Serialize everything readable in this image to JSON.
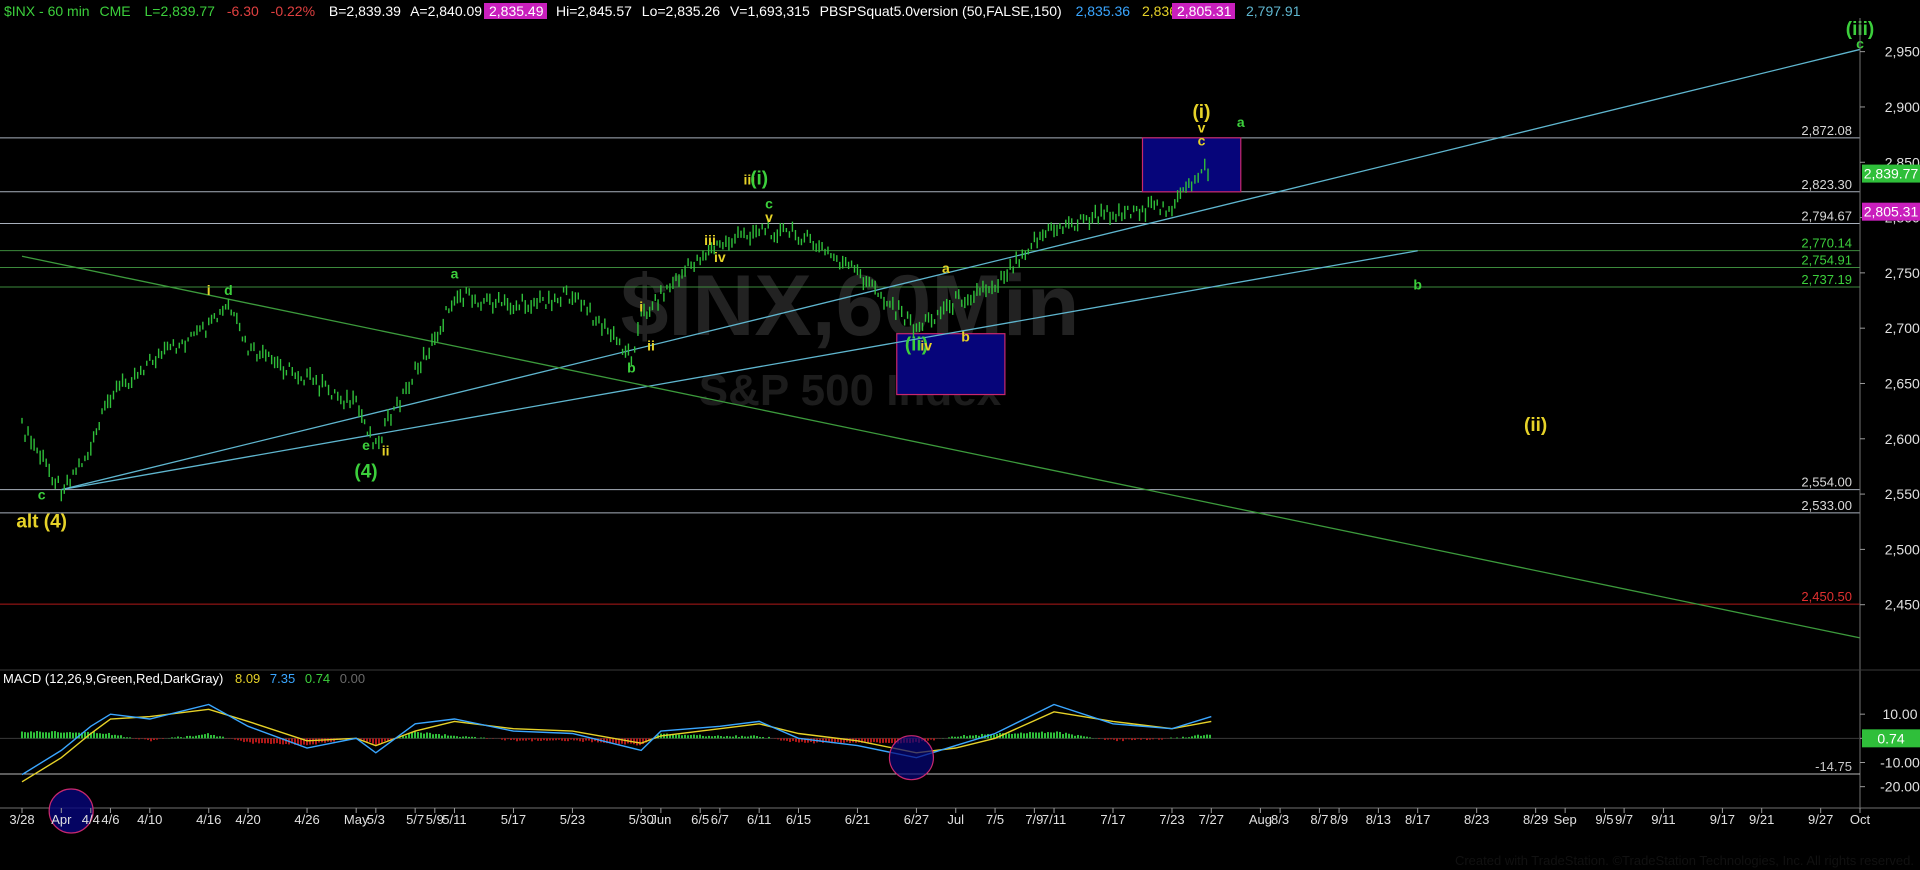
{
  "header": {
    "symbol": "$INX - 60 min",
    "exchange": "CME",
    "last": "L=2,839.77",
    "change": "-6.30",
    "change_pct": "-0.22%",
    "bid": "B=2,839.39",
    "ask": "A=2,840.09",
    "boxed_value": "2,835.49",
    "hi": "Hi=2,845.57",
    "lo": "Lo=2,835.26",
    "volume": "V=1,693,315",
    "study": "PBSPSquat5.0version (50,FALSE,150)",
    "study_values": [
      "2,835.36",
      "2,836.77",
      "2,805.31",
      "2,797.91"
    ]
  },
  "watermark": {
    "big": "$INX,60Min",
    "small": "S&P 500 Index"
  },
  "macd_header": {
    "label": "MACD (12,26,9,Green,Red,DarkGray)",
    "values": [
      "8.09",
      "7.35",
      "0.74",
      "0.00"
    ]
  },
  "footer": "Created with TradeStation. ©TradeStation Technologies, Inc. All rights reserved.",
  "colors": {
    "background": "#000000",
    "price": "#2fbf3a",
    "trendline": "#5fb6cf",
    "downline": "#3c9a3c",
    "level_line": "#a8b0bc",
    "level_line_green": "#3c8a3c",
    "support_red": "#b01818",
    "box_fill": "#06057a",
    "box_border": "#c8286e",
    "green_label": "#3ccf3c",
    "yellow_label": "#e6d228",
    "macd_line": "#3aa6ff",
    "signal_line": "#e6d228",
    "hist_pos": "#2fbf3a",
    "hist_neg": "#b01818",
    "last_price_badge": "#2fbf3a",
    "magenta_badge": "#c91fbd"
  },
  "chart_data": {
    "type": "candlestick",
    "title": "$INX - 60 min",
    "x": [
      "3/28",
      "Apr",
      "4/4",
      "4/6",
      "4/10",
      "4/16",
      "4/20",
      "4/26",
      "May",
      "5/3",
      "5/7",
      "5/9",
      "5/11",
      "5/17",
      "5/23",
      "5/30",
      "Jun",
      "6/5",
      "6/7",
      "6/11",
      "6/15",
      "6/21",
      "6/27",
      "Jul",
      "7/5",
      "7/9",
      "7/11",
      "7/17",
      "7/23",
      "7/27",
      "Aug",
      "8/3",
      "8/7",
      "8/9",
      "8/13",
      "8/17",
      "8/23",
      "8/29",
      "Sep",
      "9/5",
      "9/7",
      "9/11",
      "9/17",
      "9/21",
      "9/27",
      "Oct"
    ],
    "ylim": [
      2400,
      2975
    ],
    "y_ticks": [
      "2,950.00",
      "2,900.00",
      "2,850.00",
      "2,800.00",
      "2,750.00",
      "2,700.00",
      "2,650.00",
      "2,600.00",
      "2,550.00",
      "2,500.00",
      "2,450.00"
    ],
    "price_path": [
      [
        "3/28",
        2610
      ],
      [
        "Apr",
        2555
      ],
      [
        "4/4",
        2590
      ],
      [
        "4/6",
        2640
      ],
      [
        "4/10",
        2670
      ],
      [
        "4/16",
        2700
      ],
      [
        "4/18",
        2720
      ],
      [
        "4/20",
        2680
      ],
      [
        "4/26",
        2655
      ],
      [
        "May",
        2630
      ],
      [
        "5/3",
        2595
      ],
      [
        "5/7",
        2660
      ],
      [
        "5/9",
        2690
      ],
      [
        "5/11",
        2730
      ],
      [
        "5/17",
        2720
      ],
      [
        "5/23",
        2730
      ],
      [
        "5/29",
        2675
      ],
      [
        "5/30",
        2710
      ],
      [
        "Jun",
        2730
      ],
      [
        "6/5",
        2765
      ],
      [
        "6/7",
        2775
      ],
      [
        "6/11",
        2790
      ],
      [
        "6/15",
        2785
      ],
      [
        "6/21",
        2750
      ],
      [
        "6/27",
        2700
      ],
      [
        "Jul",
        2725
      ],
      [
        "7/5",
        2740
      ],
      [
        "7/9",
        2780
      ],
      [
        "7/11",
        2790
      ],
      [
        "7/17",
        2805
      ],
      [
        "7/23",
        2810
      ],
      [
        "7/25",
        2830
      ],
      [
        "7/26",
        2845
      ],
      [
        "7/27",
        2839.77
      ]
    ],
    "horizontal_levels": [
      {
        "value": 2872.08,
        "label": "2,872.08"
      },
      {
        "value": 2823.3,
        "label": "2,823.30"
      },
      {
        "value": 2794.67,
        "label": "2,794.67"
      },
      {
        "value": 2770.14,
        "label": "2,770.14"
      },
      {
        "value": 2754.91,
        "label": "2,754.91"
      },
      {
        "value": 2737.19,
        "label": "2,737.19"
      },
      {
        "value": 2554.0,
        "label": "2,554.00"
      },
      {
        "value": 2533.0,
        "label": "2,533.00"
      },
      {
        "value": 2450.5,
        "label": "2,450.50"
      }
    ],
    "last_price": {
      "value": 2839.77,
      "label": "2,839.77"
    },
    "secondary_badge": {
      "value": 2805.31,
      "label": "2,805.31"
    },
    "trendlines": [
      {
        "from": [
          "Apr",
          2554
        ],
        "to": [
          "Oct",
          2952
        ]
      },
      {
        "from": [
          "Apr",
          2554
        ],
        "to": [
          "8/17",
          2770
        ]
      },
      {
        "from": [
          "3/28",
          2765
        ],
        "to": [
          "Oct",
          2420
        ]
      }
    ],
    "boxes": [
      {
        "x0": "7/20",
        "x1": "7/30",
        "y0": 2823.3,
        "y1": 2872.08
      },
      {
        "x0": "6/25",
        "x1": "7/6",
        "y0": 2640,
        "y1": 2695
      }
    ],
    "wave_labels": [
      {
        "text": "alt (4)",
        "x": "3/30",
        "y": 2520,
        "color": "yellow"
      },
      {
        "text": "c",
        "x": "3/30",
        "y": 2545,
        "color": "green"
      },
      {
        "text": "i",
        "x": "4/16",
        "y": 2730,
        "color": "yellow"
      },
      {
        "text": "d",
        "x": "4/18",
        "y": 2730,
        "color": "green"
      },
      {
        "text": "e",
        "x": "5/2",
        "y": 2590,
        "color": "green"
      },
      {
        "text": "(4)",
        "x": "5/2",
        "y": 2565,
        "color": "green"
      },
      {
        "text": "ii",
        "x": "5/4",
        "y": 2585,
        "color": "yellow"
      },
      {
        "text": "a",
        "x": "5/11",
        "y": 2745,
        "color": "green"
      },
      {
        "text": "b",
        "x": "5/29",
        "y": 2660,
        "color": "green"
      },
      {
        "text": "i",
        "x": "5/30",
        "y": 2715,
        "color": "yellow"
      },
      {
        "text": "ii",
        "x": "5/31",
        "y": 2680,
        "color": "yellow"
      },
      {
        "text": "iii",
        "x": "6/6",
        "y": 2775,
        "color": "yellow"
      },
      {
        "text": "iv",
        "x": "6/7",
        "y": 2760,
        "color": "yellow"
      },
      {
        "text": "iii",
        "x": "6/10",
        "y": 2830,
        "color": "yellow"
      },
      {
        "text": "(i)",
        "x": "6/11",
        "y": 2830,
        "color": "green"
      },
      {
        "text": "c",
        "x": "6/12",
        "y": 2808,
        "color": "green"
      },
      {
        "text": "v",
        "x": "6/12",
        "y": 2796,
        "color": "yellow"
      },
      {
        "text": "(ii)",
        "x": "6/27",
        "y": 2680,
        "color": "green"
      },
      {
        "text": "iv",
        "x": "6/28",
        "y": 2680,
        "color": "yellow"
      },
      {
        "text": "a",
        "x": "6/30",
        "y": 2750,
        "color": "yellow"
      },
      {
        "text": "b",
        "x": "7/2",
        "y": 2688,
        "color": "yellow"
      },
      {
        "text": "(i)",
        "x": "7/26",
        "y": 2890,
        "color": "yellow"
      },
      {
        "text": "v",
        "x": "7/26",
        "y": 2877,
        "color": "yellow"
      },
      {
        "text": "c",
        "x": "7/26",
        "y": 2865,
        "color": "yellow"
      },
      {
        "text": "a",
        "x": "7/30",
        "y": 2882,
        "color": "green"
      },
      {
        "text": "b",
        "x": "8/17",
        "y": 2735,
        "color": "green"
      },
      {
        "text": "(ii)",
        "x": "8/29",
        "y": 2607,
        "color": "yellow"
      },
      {
        "text": "(iii)",
        "x": "10/1",
        "y": 2965,
        "color": "green"
      },
      {
        "text": "c",
        "x": "10/1",
        "y": 2953,
        "color": "green"
      }
    ],
    "macd": {
      "ylim": [
        -28,
        20
      ],
      "y_ticks": [
        "10.00",
        "0.00",
        "-10.00",
        "-20.00"
      ],
      "zero_badge": "0.74",
      "lower_line": {
        "value": -14.75,
        "label": "-14.75"
      },
      "macd_path": [
        [
          "3/28",
          -15
        ],
        [
          "Apr",
          -5
        ],
        [
          "4/4",
          5
        ],
        [
          "4/6",
          10
        ],
        [
          "4/10",
          8
        ],
        [
          "4/16",
          14
        ],
        [
          "4/20",
          5
        ],
        [
          "4/26",
          -4
        ],
        [
          "May",
          0
        ],
        [
          "5/3",
          -6
        ],
        [
          "5/7",
          6
        ],
        [
          "5/11",
          8
        ],
        [
          "5/17",
          3
        ],
        [
          "5/23",
          2
        ],
        [
          "5/30",
          -5
        ],
        [
          "Jun",
          3
        ],
        [
          "6/7",
          5
        ],
        [
          "6/11",
          7
        ],
        [
          "6/15",
          0
        ],
        [
          "6/21",
          -3
        ],
        [
          "6/27",
          -8
        ],
        [
          "Jul",
          -3
        ],
        [
          "7/5",
          2
        ],
        [
          "7/11",
          14
        ],
        [
          "7/17",
          6
        ],
        [
          "7/23",
          4
        ],
        [
          "7/27",
          9
        ]
      ],
      "signal_path": [
        [
          "3/28",
          -18
        ],
        [
          "Apr",
          -8
        ],
        [
          "4/4",
          2
        ],
        [
          "4/6",
          8
        ],
        [
          "4/10",
          9
        ],
        [
          "4/16",
          12
        ],
        [
          "4/20",
          7
        ],
        [
          "4/26",
          -1
        ],
        [
          "May",
          0
        ],
        [
          "5/3",
          -3
        ],
        [
          "5/7",
          3
        ],
        [
          "5/11",
          7
        ],
        [
          "5/17",
          4
        ],
        [
          "5/23",
          3
        ],
        [
          "5/30",
          -2
        ],
        [
          "Jun",
          1
        ],
        [
          "6/7",
          4
        ],
        [
          "6/11",
          6
        ],
        [
          "6/15",
          2
        ],
        [
          "6/21",
          -1
        ],
        [
          "6/27",
          -6
        ],
        [
          "Jul",
          -4
        ],
        [
          "7/5",
          0
        ],
        [
          "7/11",
          11
        ],
        [
          "7/17",
          7
        ],
        [
          "7/23",
          4
        ],
        [
          "7/27",
          7
        ]
      ]
    }
  }
}
